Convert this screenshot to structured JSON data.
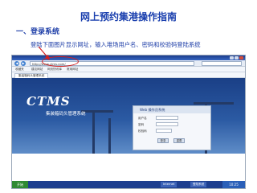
{
  "slide": {
    "title": "网上预约集港操作指南",
    "section": "一、登录系统",
    "description": "登陆下面图片显示网址，输入堆场用户名、密码和校验码登陆系统"
  },
  "browser": {
    "url": "http://www.ctms.com/",
    "favorites": [
      "收藏夹",
      "建议网站",
      "网页快讯库",
      "常用网址"
    ],
    "tab_label": "集装箱码头管理系统"
  },
  "app": {
    "logo": "CTMS",
    "subtitle": "集装箱码头管理系统",
    "login_title": "Web 操作员系统",
    "user_label": "用户名",
    "password_label": "密码",
    "code_label": "校验码",
    "login_button": "登录",
    "reset_button": "重置"
  },
  "taskbar": {
    "start_label": "开始",
    "items": [
      "Internet",
      "登陆系统"
    ],
    "clock": "10:25"
  },
  "colors": {
    "heading": "#1a3fae",
    "highlight": "#d51f1f"
  }
}
